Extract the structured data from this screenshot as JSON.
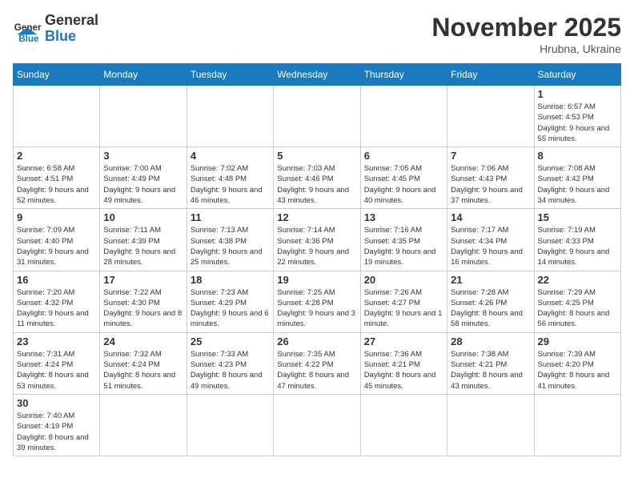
{
  "header": {
    "logo_general": "General",
    "logo_blue": "Blue",
    "month_title": "November 2025",
    "location": "Hrubna, Ukraine"
  },
  "weekdays": [
    "Sunday",
    "Monday",
    "Tuesday",
    "Wednesday",
    "Thursday",
    "Friday",
    "Saturday"
  ],
  "weeks": [
    [
      {
        "day": "",
        "info": ""
      },
      {
        "day": "",
        "info": ""
      },
      {
        "day": "",
        "info": ""
      },
      {
        "day": "",
        "info": ""
      },
      {
        "day": "",
        "info": ""
      },
      {
        "day": "",
        "info": ""
      },
      {
        "day": "1",
        "info": "Sunrise: 6:57 AM\nSunset: 4:53 PM\nDaylight: 9 hours and 55 minutes."
      }
    ],
    [
      {
        "day": "2",
        "info": "Sunrise: 6:58 AM\nSunset: 4:51 PM\nDaylight: 9 hours and 52 minutes."
      },
      {
        "day": "3",
        "info": "Sunrise: 7:00 AM\nSunset: 4:49 PM\nDaylight: 9 hours and 49 minutes."
      },
      {
        "day": "4",
        "info": "Sunrise: 7:02 AM\nSunset: 4:48 PM\nDaylight: 9 hours and 46 minutes."
      },
      {
        "day": "5",
        "info": "Sunrise: 7:03 AM\nSunset: 4:46 PM\nDaylight: 9 hours and 43 minutes."
      },
      {
        "day": "6",
        "info": "Sunrise: 7:05 AM\nSunset: 4:45 PM\nDaylight: 9 hours and 40 minutes."
      },
      {
        "day": "7",
        "info": "Sunrise: 7:06 AM\nSunset: 4:43 PM\nDaylight: 9 hours and 37 minutes."
      },
      {
        "day": "8",
        "info": "Sunrise: 7:08 AM\nSunset: 4:42 PM\nDaylight: 9 hours and 34 minutes."
      }
    ],
    [
      {
        "day": "9",
        "info": "Sunrise: 7:09 AM\nSunset: 4:40 PM\nDaylight: 9 hours and 31 minutes."
      },
      {
        "day": "10",
        "info": "Sunrise: 7:11 AM\nSunset: 4:39 PM\nDaylight: 9 hours and 28 minutes."
      },
      {
        "day": "11",
        "info": "Sunrise: 7:13 AM\nSunset: 4:38 PM\nDaylight: 9 hours and 25 minutes."
      },
      {
        "day": "12",
        "info": "Sunrise: 7:14 AM\nSunset: 4:36 PM\nDaylight: 9 hours and 22 minutes."
      },
      {
        "day": "13",
        "info": "Sunrise: 7:16 AM\nSunset: 4:35 PM\nDaylight: 9 hours and 19 minutes."
      },
      {
        "day": "14",
        "info": "Sunrise: 7:17 AM\nSunset: 4:34 PM\nDaylight: 9 hours and 16 minutes."
      },
      {
        "day": "15",
        "info": "Sunrise: 7:19 AM\nSunset: 4:33 PM\nDaylight: 9 hours and 14 minutes."
      }
    ],
    [
      {
        "day": "16",
        "info": "Sunrise: 7:20 AM\nSunset: 4:32 PM\nDaylight: 9 hours and 11 minutes."
      },
      {
        "day": "17",
        "info": "Sunrise: 7:22 AM\nSunset: 4:30 PM\nDaylight: 9 hours and 8 minutes."
      },
      {
        "day": "18",
        "info": "Sunrise: 7:23 AM\nSunset: 4:29 PM\nDaylight: 9 hours and 6 minutes."
      },
      {
        "day": "19",
        "info": "Sunrise: 7:25 AM\nSunset: 4:28 PM\nDaylight: 9 hours and 3 minutes."
      },
      {
        "day": "20",
        "info": "Sunrise: 7:26 AM\nSunset: 4:27 PM\nDaylight: 9 hours and 1 minute."
      },
      {
        "day": "21",
        "info": "Sunrise: 7:28 AM\nSunset: 4:26 PM\nDaylight: 8 hours and 58 minutes."
      },
      {
        "day": "22",
        "info": "Sunrise: 7:29 AM\nSunset: 4:25 PM\nDaylight: 8 hours and 56 minutes."
      }
    ],
    [
      {
        "day": "23",
        "info": "Sunrise: 7:31 AM\nSunset: 4:24 PM\nDaylight: 8 hours and 53 minutes."
      },
      {
        "day": "24",
        "info": "Sunrise: 7:32 AM\nSunset: 4:24 PM\nDaylight: 8 hours and 51 minutes."
      },
      {
        "day": "25",
        "info": "Sunrise: 7:33 AM\nSunset: 4:23 PM\nDaylight: 8 hours and 49 minutes."
      },
      {
        "day": "26",
        "info": "Sunrise: 7:35 AM\nSunset: 4:22 PM\nDaylight: 8 hours and 47 minutes."
      },
      {
        "day": "27",
        "info": "Sunrise: 7:36 AM\nSunset: 4:21 PM\nDaylight: 8 hours and 45 minutes."
      },
      {
        "day": "28",
        "info": "Sunrise: 7:38 AM\nSunset: 4:21 PM\nDaylight: 8 hours and 43 minutes."
      },
      {
        "day": "29",
        "info": "Sunrise: 7:39 AM\nSunset: 4:20 PM\nDaylight: 8 hours and 41 minutes."
      }
    ],
    [
      {
        "day": "30",
        "info": "Sunrise: 7:40 AM\nSunset: 4:19 PM\nDaylight: 8 hours and 39 minutes."
      },
      {
        "day": "",
        "info": ""
      },
      {
        "day": "",
        "info": ""
      },
      {
        "day": "",
        "info": ""
      },
      {
        "day": "",
        "info": ""
      },
      {
        "day": "",
        "info": ""
      },
      {
        "day": "",
        "info": ""
      }
    ]
  ]
}
